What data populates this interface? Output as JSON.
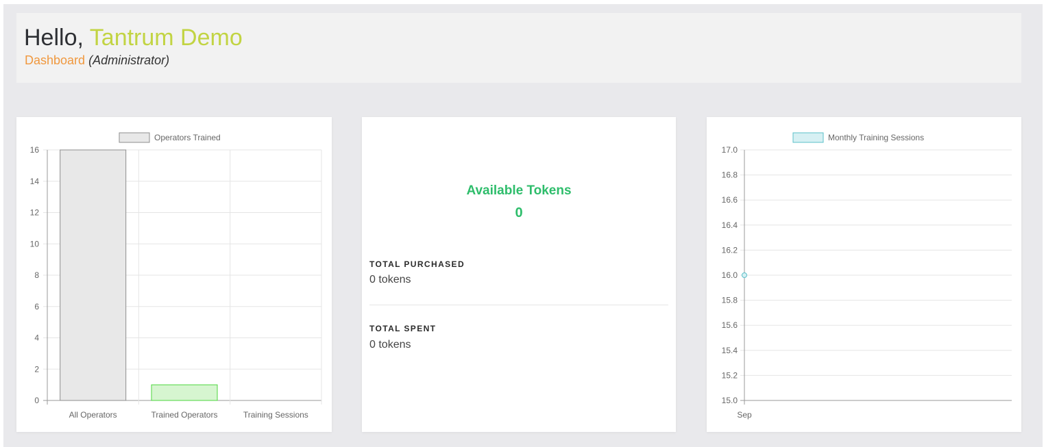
{
  "header": {
    "greeting": "Hello,",
    "user_name": "Tantrum Demo",
    "dashboard_label": "Dashboard",
    "role_label": "(Administrator)"
  },
  "tokens": {
    "title": "Available Tokens",
    "available": "0",
    "total_purchased_label": "TOTAL PURCHASED",
    "total_purchased_value": "0 tokens",
    "total_spent_label": "TOTAL SPENT",
    "total_spent_value": "0 tokens"
  },
  "chart_data": [
    {
      "type": "bar",
      "legend": "Operators Trained",
      "categories": [
        "All Operators",
        "Trained Operators",
        "Training Sessions"
      ],
      "values": [
        16,
        1,
        0
      ],
      "ylim": [
        0,
        16
      ],
      "yticks": [
        "0",
        "2",
        "4",
        "6",
        "8",
        "10",
        "12",
        "14",
        "16"
      ],
      "colors": {
        "fill": [
          "#e8e8e8",
          "#d6f5d0",
          "#e8e8e8"
        ],
        "stroke": [
          "#8e8e8e",
          "#4cd63c",
          "#8e8e8e"
        ]
      },
      "grid": true,
      "legend_position": "top"
    },
    {
      "type": "line",
      "legend": "Monthly Training Sessions",
      "categories": [
        "Sep"
      ],
      "values": [
        16
      ],
      "ylim": [
        15,
        17
      ],
      "yticks": [
        "15.0",
        "15.2",
        "15.4",
        "15.6",
        "15.8",
        "16.0",
        "16.2",
        "16.4",
        "16.6",
        "16.8",
        "17.0"
      ],
      "colors": {
        "fill": "#d6f0f3",
        "stroke": "#5bc0c9"
      },
      "grid": true,
      "legend_position": "top"
    }
  ]
}
